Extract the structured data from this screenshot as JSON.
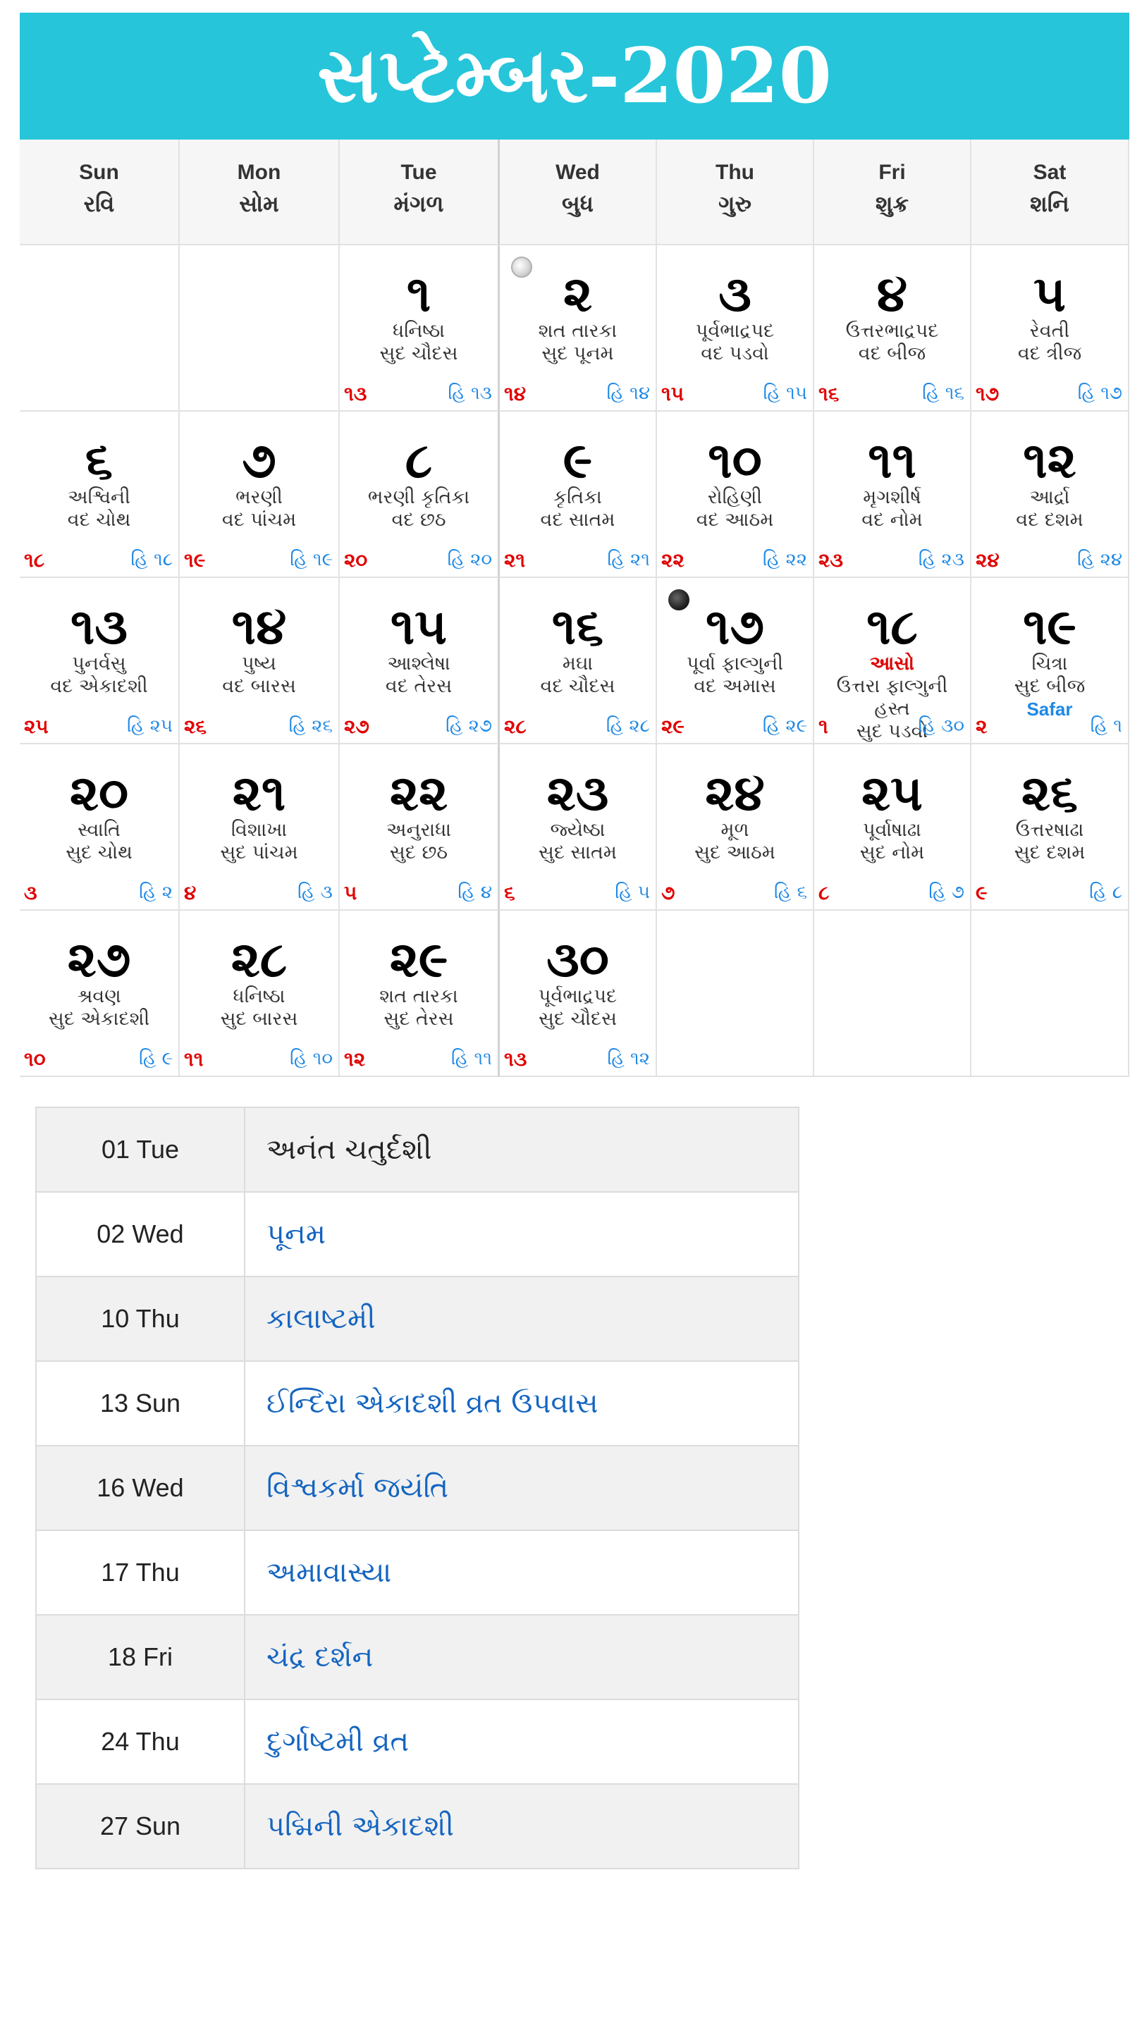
{
  "header": {
    "month": "સપ્ટેમ્બર",
    "separator": "-",
    "year": "2020"
  },
  "weekdays": [
    {
      "en": "Sun",
      "gu": "રવિ"
    },
    {
      "en": "Mon",
      "gu": "સોમ"
    },
    {
      "en": "Tue",
      "gu": "મંગળ"
    },
    {
      "en": "Wed",
      "gu": "બુધ"
    },
    {
      "en": "Thu",
      "gu": "ગુરુ"
    },
    {
      "en": "Fri",
      "gu": "શુક્ર"
    },
    {
      "en": "Sat",
      "gu": "શનિ"
    }
  ],
  "weeks": [
    [
      {
        "empty": true
      },
      {
        "empty": true
      },
      {
        "date": "૧",
        "nakshatra": "ધનિષ્ઠા",
        "tithi": "સુદ ચૌદસ",
        "left": "૧૩",
        "right": "હિ ૧૩"
      },
      {
        "date": "૨",
        "nakshatra": "શત તારકા",
        "tithi": "સુદ પૂનમ",
        "left": "૧૪",
        "right": "હિ ૧૪",
        "moon": "full"
      },
      {
        "date": "૩",
        "nakshatra": "પૂર્વભાદ્રપદ",
        "tithi": "વદ પડવો",
        "left": "૧૫",
        "right": "હિ ૧૫"
      },
      {
        "date": "૪",
        "nakshatra": "ઉત્તરભાદ્રપદ",
        "tithi": "વદ બીજ",
        "left": "૧૬",
        "right": "હિ ૧૬"
      },
      {
        "date": "૫",
        "nakshatra": "રેવતી",
        "tithi": "વદ ત્રીજ",
        "left": "૧૭",
        "right": "હિ ૧૭"
      }
    ],
    [
      {
        "date": "૬",
        "nakshatra": "અશ્વિની",
        "tithi": "વદ ચોથ",
        "left": "૧૮",
        "right": "હિ ૧૮"
      },
      {
        "date": "૭",
        "nakshatra": "ભરણી",
        "tithi": "વદ પાંચમ",
        "left": "૧૯",
        "right": "હિ ૧૯"
      },
      {
        "date": "૮",
        "nakshatra": "ભરણી કૃતિકા",
        "tithi": "વદ છઠ",
        "left": "૨૦",
        "right": "હિ ૨૦"
      },
      {
        "date": "૯",
        "nakshatra": "કૃતિકા",
        "tithi": "વદ સાતમ",
        "left": "૨૧",
        "right": "હિ ૨૧"
      },
      {
        "date": "૧૦",
        "nakshatra": "રોહિણી",
        "tithi": "વદ આઠમ",
        "left": "૨૨",
        "right": "હિ ૨૨"
      },
      {
        "date": "૧૧",
        "nakshatra": "મૃગશીર્ષ",
        "tithi": "વદ નોમ",
        "left": "૨૩",
        "right": "હિ ૨૩"
      },
      {
        "date": "૧૨",
        "nakshatra": "આર્દ્રા",
        "tithi": "વદ દશમ",
        "left": "૨૪",
        "right": "હિ ૨૪"
      }
    ],
    [
      {
        "date": "૧૩",
        "nakshatra": "પુનર્વસુ",
        "tithi": "વદ એકાદશી",
        "left": "૨૫",
        "right": "હિ ૨૫"
      },
      {
        "date": "૧૪",
        "nakshatra": "પુષ્ય",
        "tithi": "વદ બારસ",
        "left": "૨૬",
        "right": "હિ ૨૬"
      },
      {
        "date": "૧૫",
        "nakshatra": "આશ્લેષા",
        "tithi": "વદ તેરસ",
        "left": "૨૭",
        "right": "હિ ૨૭"
      },
      {
        "date": "૧૬",
        "nakshatra": "મઘા",
        "tithi": "વદ ચૌદસ",
        "left": "૨૮",
        "right": "હિ ૨૮"
      },
      {
        "date": "૧૭",
        "nakshatra": "પૂર્વા ફાલ્ગુની",
        "tithi": "વદ અમાસ",
        "left": "૨૯",
        "right": "હિ ૨૯",
        "moon": "new"
      },
      {
        "date": "૧૮",
        "festival": "આસો",
        "nakshatra": "ઉત્તરા ફાલ્ગુની",
        "nakshatra2": "હસ્ત",
        "tithi": "સુદ પડવો",
        "left": "૧",
        "right": "હિ ૩૦"
      },
      {
        "date": "૧૯",
        "nakshatra": "ચિત્રા",
        "tithi": "સુદ બીજ",
        "islamic_month": "Safar",
        "left": "૨",
        "right": "હિ ૧"
      }
    ],
    [
      {
        "date": "૨૦",
        "nakshatra": "સ્વાતિ",
        "tithi": "સુદ ચોથ",
        "left": "૩",
        "right": "હિ ૨"
      },
      {
        "date": "૨૧",
        "nakshatra": "વિશાખા",
        "tithi": "સુદ પાંચમ",
        "left": "૪",
        "right": "હિ ૩"
      },
      {
        "date": "૨૨",
        "nakshatra": "અનુરાધા",
        "tithi": "સુદ છઠ",
        "left": "૫",
        "right": "હિ ૪"
      },
      {
        "date": "૨૩",
        "nakshatra": "જ્યેષ્ઠા",
        "tithi": "સુદ સાતમ",
        "left": "૬",
        "right": "હિ ૫"
      },
      {
        "date": "૨૪",
        "nakshatra": "મૂળ",
        "tithi": "સુદ આઠમ",
        "left": "૭",
        "right": "હિ ૬"
      },
      {
        "date": "૨૫",
        "nakshatra": "પૂર્વાષાઢા",
        "tithi": "સુદ નોમ",
        "left": "૮",
        "right": "હિ ૭"
      },
      {
        "date": "૨૬",
        "nakshatra": "ઉત્તરષાઢા",
        "tithi": "સુદ દશમ",
        "left": "૯",
        "right": "હિ ૮"
      }
    ],
    [
      {
        "date": "૨૭",
        "nakshatra": "શ્રવણ",
        "tithi": "સુદ એકાદશી",
        "left": "૧૦",
        "right": "હિ ૯"
      },
      {
        "date": "૨૮",
        "nakshatra": "ધનિષ્ઠા",
        "tithi": "સુદ બારસ",
        "left": "૧૧",
        "right": "હિ ૧૦"
      },
      {
        "date": "૨૯",
        "nakshatra": "શત તારકા",
        "tithi": "સુદ તેરસ",
        "left": "૧૨",
        "right": "હિ ૧૧"
      },
      {
        "date": "૩૦",
        "nakshatra": "પૂર્વભાદ્રપદ",
        "tithi": "સુદ ચૌદસ",
        "left": "૧૩",
        "right": "હિ ૧૨"
      },
      {
        "empty": true
      },
      {
        "empty": true
      },
      {
        "empty": true
      }
    ]
  ],
  "events": [
    {
      "day": "01 Tue",
      "name": "અનંત ચતુર્દશી"
    },
    {
      "day": "02 Wed",
      "name": "પૂનમ"
    },
    {
      "day": "10 Thu",
      "name": "કાલાષ્ટમી"
    },
    {
      "day": "13 Sun",
      "name": "ઈન્દિરા એકાદશી વ્રત ઉપવાસ"
    },
    {
      "day": "16 Wed",
      "name": "વિશ્વકર્મા જયંતિ"
    },
    {
      "day": "17 Thu",
      "name": "અમાવાસ્યા"
    },
    {
      "day": "18 Fri",
      "name": "ચંદ્ર દર્શન"
    },
    {
      "day": "24 Thu",
      "name": "દુર્ગાષ્ટમી વ્રત"
    },
    {
      "day": "27 Sun",
      "name": "પદ્મિની એકાદશી"
    }
  ],
  "colors": {
    "banner": "#26c5da",
    "red_number": "#e00000",
    "blue_number": "#1e88e5",
    "event_link": "#1565c0"
  }
}
